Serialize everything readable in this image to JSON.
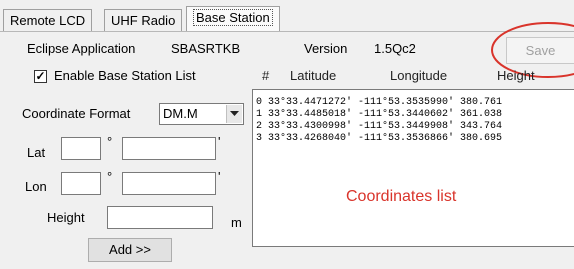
{
  "tabs": [
    {
      "label": "Remote LCD",
      "active": false
    },
    {
      "label": "UHF Radio",
      "active": false
    },
    {
      "label": "Base Station",
      "active": true
    }
  ],
  "header": {
    "app_label": "Eclipse Application",
    "app_value": "SBASRTKB",
    "version_label": "Version",
    "version_value": "1.5Qc2",
    "save_label": "Save"
  },
  "enable_list": {
    "label": "Enable Base Station List",
    "checked": true,
    "check_glyph": "✓"
  },
  "coordinate_format": {
    "label": "Coordinate Format",
    "selected": "DM.M"
  },
  "lat": {
    "label": "Lat",
    "deg_symbol": "°",
    "min_symbol": "'"
  },
  "lon": {
    "label": "Lon",
    "deg_symbol": "°",
    "min_symbol": "'"
  },
  "height": {
    "label": "Height",
    "unit": "m"
  },
  "add_label": "Add >>",
  "list": {
    "columns": [
      "#",
      "Latitude",
      "Longitude",
      "Height"
    ],
    "rows": [
      "0 33°33.4471272' -111°53.3535990' 380.761",
      "1 33°33.4485018' -111°53.3440602' 361.038",
      "2 33°33.4300998' -111°53.3449908' 343.764",
      "3 33°33.4268040' -111°53.3536866' 380.695"
    ]
  },
  "annotation": {
    "text": "Coordinates list",
    "color": "#d9342b"
  },
  "icons": {
    "dropdown": "chevron-down-icon",
    "highlight": "red-circle-highlight"
  }
}
